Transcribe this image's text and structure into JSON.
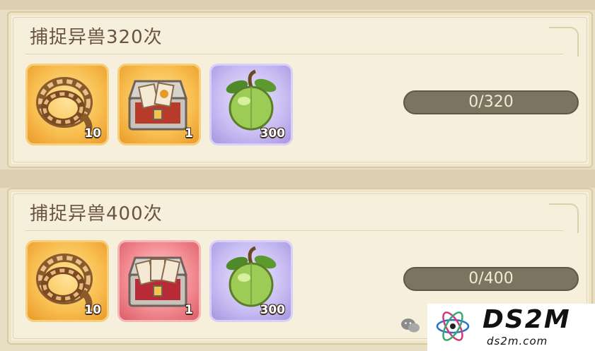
{
  "tasks": [
    {
      "title": "捕捉异兽320次",
      "rewards": [
        {
          "icon": "rope-icon",
          "qty": "10",
          "frame": "gold"
        },
        {
          "icon": "treasure-chest-icon",
          "qty": "1",
          "frame": "gold"
        },
        {
          "icon": "green-fruit-icon",
          "qty": "300",
          "frame": "purple"
        }
      ],
      "progress_text": "0/320",
      "progress_fraction": 0
    },
    {
      "title": "捕捉异兽400次",
      "rewards": [
        {
          "icon": "rope-icon",
          "qty": "10",
          "frame": "gold"
        },
        {
          "icon": "treasure-chest-icon",
          "qty": "1",
          "frame": "red"
        },
        {
          "icon": "green-fruit-icon",
          "qty": "300",
          "frame": "purple"
        }
      ],
      "progress_text": "0/400",
      "progress_fraction": 0
    }
  ],
  "watermark": {
    "brand": "DS2M",
    "domain": "ds2m.com"
  },
  "colors": {
    "card_bg": "#f6efdc",
    "title": "#6a5440",
    "progress_track": "#7b7460",
    "gold_frame": "#f8bd4e",
    "red_frame": "#f38e95",
    "purple_frame": "#c7bbf2"
  }
}
